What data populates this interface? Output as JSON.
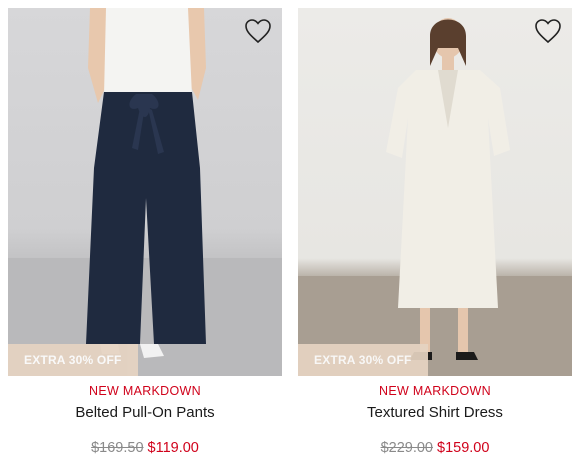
{
  "products": [
    {
      "badge": "EXTRA 30% OFF",
      "tag": "NEW MARKDOWN",
      "name": "Belted Pull-On Pants",
      "original_price": "$169.50",
      "sale_price": "$119.00",
      "icon": "heart-outline-icon"
    },
    {
      "badge": "EXTRA 30% OFF",
      "tag": "NEW MARKDOWN",
      "name": "Textured Shirt Dress",
      "original_price": "$229.00",
      "sale_price": "$159.00",
      "icon": "heart-outline-icon"
    }
  ],
  "colors": {
    "markdown_red": "#d0021b",
    "badge_bg": "#e6d4c2",
    "strike_gray": "#8a8a8a"
  }
}
